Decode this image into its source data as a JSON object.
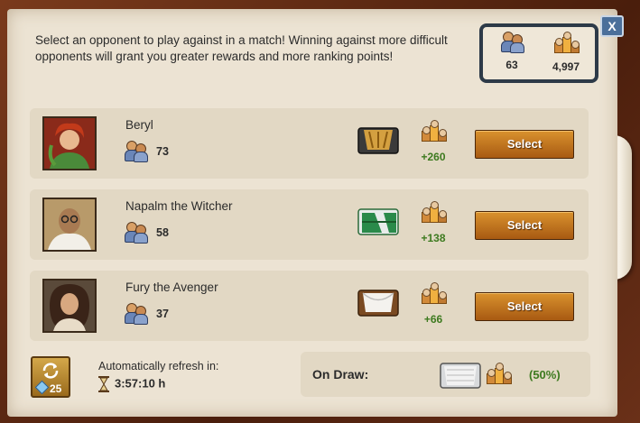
{
  "intro_text": "Select an opponent to play against in a match! Winning against more difficult opponents will grant you greater rewards and more ranking points!",
  "close_label": "X",
  "stats": {
    "rank": "63",
    "points": "4,997"
  },
  "opponents": [
    {
      "name": "Beryl",
      "rank": "73",
      "reward": "+260",
      "button": "Select"
    },
    {
      "name": "Napalm the Witcher",
      "rank": "58",
      "reward": "+138",
      "button": "Select"
    },
    {
      "name": "Fury the Avenger",
      "rank": "37",
      "reward": "+66",
      "button": "Select"
    }
  ],
  "refresh": {
    "cost": "25",
    "label": "Automatically refresh in:",
    "timer": "3:57:10 h"
  },
  "draw": {
    "label": "On Draw:",
    "percent": "(50%)"
  },
  "colors": {
    "button": "#c47a22",
    "reward_green": "#3d7a1f",
    "stats_border": "#2d3a48"
  }
}
